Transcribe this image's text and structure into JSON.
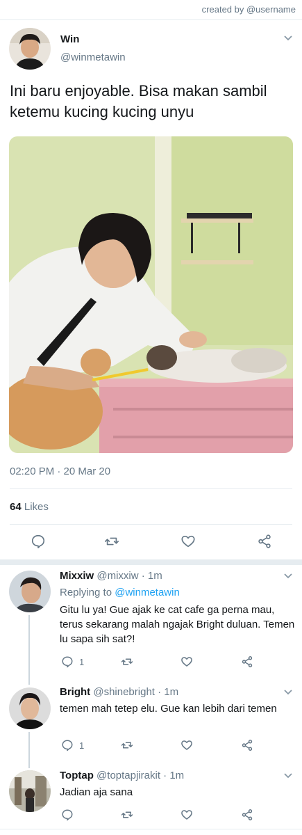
{
  "credit": "created by @username",
  "main_tweet": {
    "name": "Win",
    "handle": "@winmetawin",
    "text": "Ini baru enjoyable. Bisa makan sambil ketemu kucing kucing unyu",
    "timestamp": "02:20 PM · 20 Mar 20",
    "likes_count": "64",
    "likes_label": "Likes"
  },
  "replies": [
    {
      "name": "Mixxiw",
      "handle": "@mixxiw",
      "time": "· 1m",
      "replying_prefix": "Replying to",
      "replying_handle": "@winmetawin",
      "text": "Gitu lu ya! Gue ajak ke cat cafe ga perna mau, terus sekarang malah ngajak Bright duluan. Temen lu sapa sih sat?!",
      "reply_count": "1"
    },
    {
      "name": "Bright",
      "handle": "@shinebright",
      "time": "· 1m",
      "text": "temen mah tetep elu. Gue kan lebih dari temen",
      "reply_count": "1"
    },
    {
      "name": "Toptap",
      "handle": "@toptapjirakit",
      "time": "· 1m",
      "text": "Jadian aja sana",
      "reply_count": ""
    }
  ],
  "icons": {
    "reply": "reply-icon",
    "retweet": "retweet-icon",
    "like": "heart-icon",
    "share": "share-icon",
    "menu": "chevron-down-icon"
  },
  "colors": {
    "accent": "#1da1f2",
    "muted": "#657786",
    "divider": "#e6ecf0",
    "wall": "#d7e2ad",
    "table": "#e8a6ae"
  }
}
